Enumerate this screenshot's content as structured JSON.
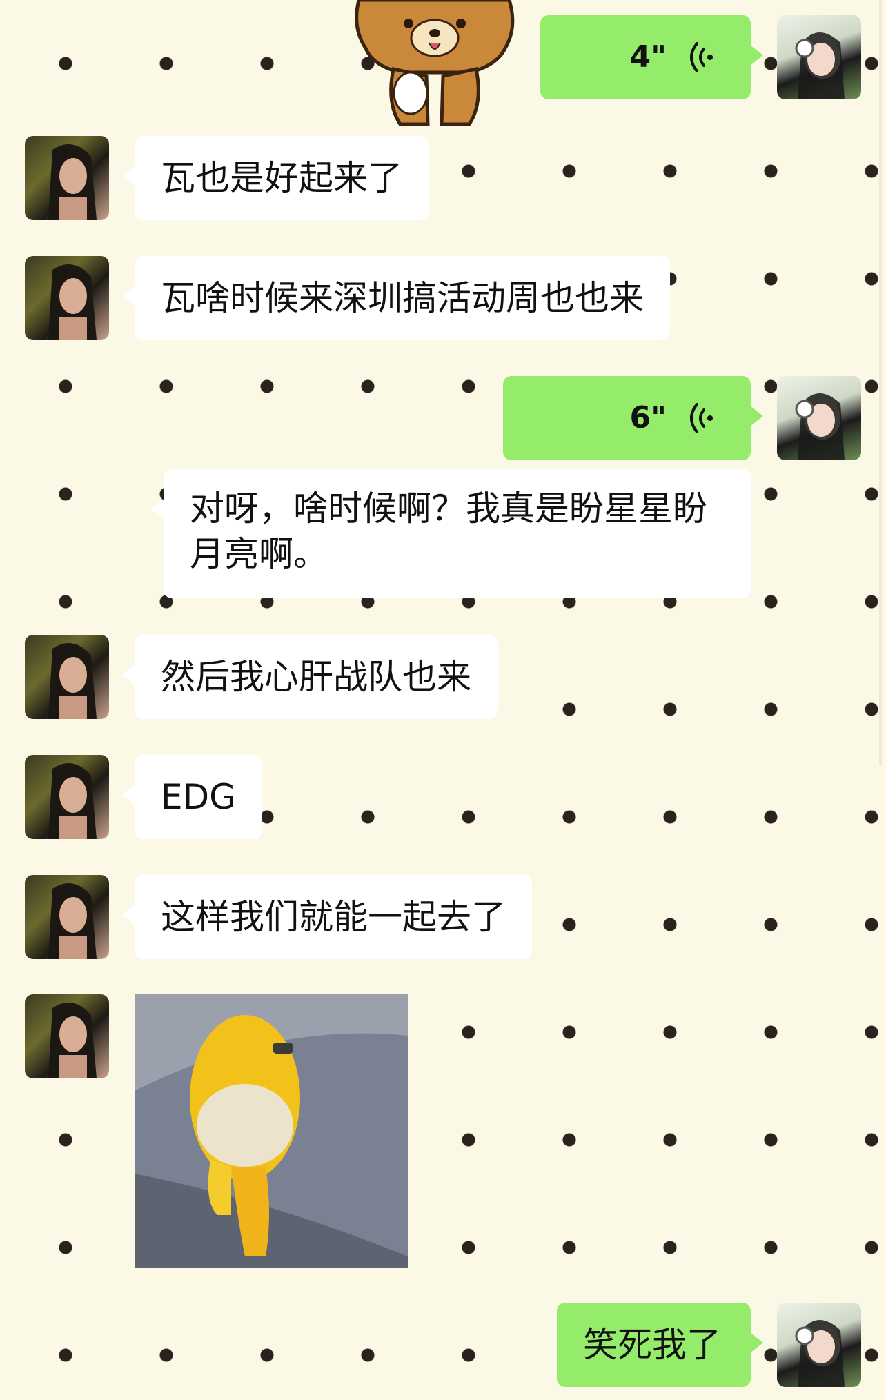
{
  "conversation": {
    "messages": [
      {
        "side": "right",
        "type": "voice",
        "duration": "4\""
      },
      {
        "side": "left",
        "type": "text",
        "text": "瓦也是好起来了"
      },
      {
        "side": "left",
        "type": "text",
        "text": "瓦啥时候来深圳搞活动周也也来"
      },
      {
        "side": "right",
        "type": "voice",
        "duration": "6\""
      },
      {
        "side": "right",
        "type": "text",
        "text": "对呀，啥时候啊？我真是盼星星盼月亮啊。"
      },
      {
        "side": "left",
        "type": "text",
        "text": "然后我心肝战队也来"
      },
      {
        "side": "left",
        "type": "text",
        "text": "EDG"
      },
      {
        "side": "left",
        "type": "text",
        "text": "这样我们就能一起去了"
      },
      {
        "side": "left",
        "type": "image",
        "content": "yellow-duck-sticker"
      },
      {
        "side": "right",
        "type": "text",
        "text": "笑死我了"
      }
    ]
  },
  "icons": {
    "voice": "voice-wave-icon",
    "bear_sticker": "brown-bear-sticker"
  },
  "colors": {
    "background": "#fbf8e6",
    "dots": "#2a231d",
    "green_bubble": "#95ec6a",
    "white_bubble": "#ffffff"
  }
}
